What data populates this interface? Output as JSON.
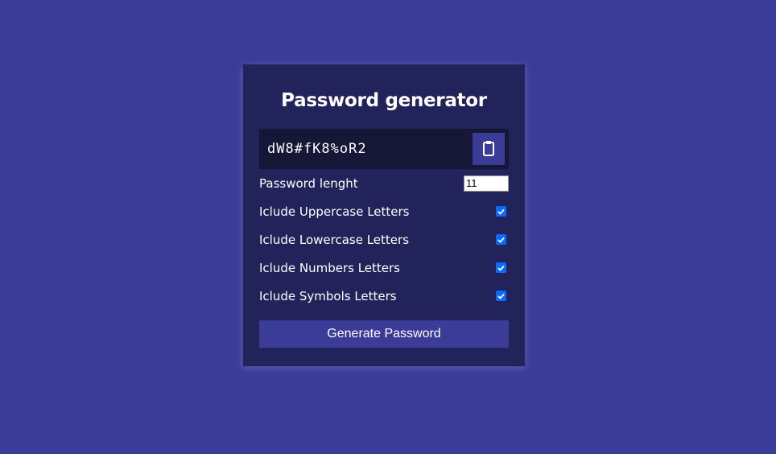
{
  "app": {
    "title": "Password generator"
  },
  "result": {
    "password": "dW8#fK8%oR2",
    "copy_icon": "clipboard-icon"
  },
  "settings": {
    "length_label": "Password lenght",
    "length_value": "11",
    "uppercase_label": "Iclude Uppercase Letters",
    "uppercase_checked": true,
    "lowercase_label": "Iclude Lowercase Letters",
    "lowercase_checked": true,
    "numbers_label": "Iclude Numbers Letters",
    "numbers_checked": true,
    "symbols_label": "Iclude Symbols Letters",
    "symbols_checked": true
  },
  "actions": {
    "generate_label": "Generate Password"
  },
  "colors": {
    "background": "#3b3b98",
    "card": "#23235b",
    "result_bg": "#161637",
    "checkbox": "#0a6cff"
  }
}
